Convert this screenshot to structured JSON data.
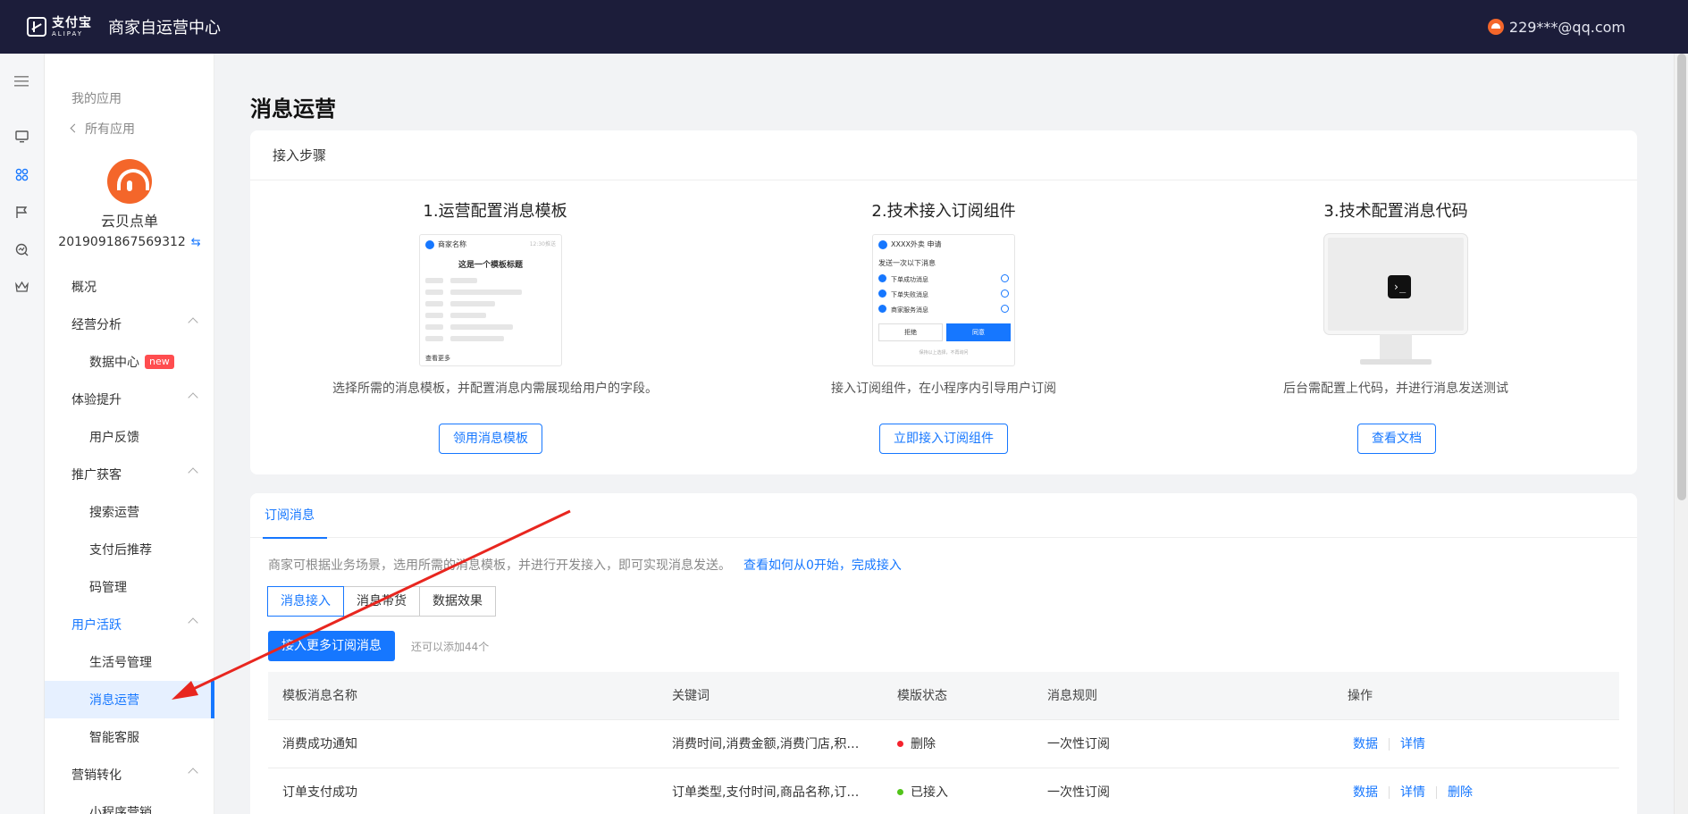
{
  "header": {
    "logo_cn": "支付宝",
    "logo_en": "ALIPAY",
    "title": "商家自运营中心",
    "user_email": "229***@qq.com"
  },
  "rail": {
    "icons": [
      "menu-icon",
      "monitor-icon",
      "apps-icon",
      "flag-icon",
      "analytics-icon",
      "crown-icon"
    ]
  },
  "sidebar": {
    "my_apps": "我的应用",
    "all_apps": "所有应用",
    "app_name": "云贝点单",
    "app_id": "2019091867569312",
    "swap_glyph": "⇆",
    "new_badge": "new",
    "items": [
      {
        "label": "概况",
        "type": "group"
      },
      {
        "label": "经营分析",
        "type": "group"
      },
      {
        "label": "数据中心",
        "type": "sub"
      },
      {
        "label": "体验提升",
        "type": "group"
      },
      {
        "label": "用户反馈",
        "type": "sub"
      },
      {
        "label": "推广获客",
        "type": "group"
      },
      {
        "label": "搜索运营",
        "type": "sub"
      },
      {
        "label": "支付后推荐",
        "type": "sub"
      },
      {
        "label": "码管理",
        "type": "sub"
      },
      {
        "label": "用户活跃",
        "type": "group"
      },
      {
        "label": "生活号管理",
        "type": "sub"
      },
      {
        "label": "消息运营",
        "type": "sub"
      },
      {
        "label": "智能客服",
        "type": "sub"
      },
      {
        "label": "营销转化",
        "type": "group"
      },
      {
        "label": "小程序营销",
        "type": "sub"
      }
    ]
  },
  "main": {
    "page_title": "消息运营",
    "steps_card": {
      "header": "接入步骤",
      "steps": [
        {
          "title": "1.运营配置消息模板",
          "desc": "选择所需的消息模板，并配置消息内需展现给用户的字段。",
          "button": "领用消息模板",
          "mock": {
            "merchant": "商家名称",
            "time": "12:30推送",
            "heading": "这是一个模板标题",
            "more": "查看更多"
          }
        },
        {
          "title": "2.技术接入订阅组件",
          "desc": "接入订阅组件，在小程序内引导用户订阅",
          "button": "立即接入订阅组件",
          "mock": {
            "merchant": "XXXX外卖 申请",
            "heading": "发送一次以下消息",
            "opt1": "下单成功消息",
            "opt2": "下单失败消息",
            "opt3": "商家服务消息",
            "reject": "拒绝",
            "agree": "同意",
            "remember": "保持以上选择，不再询问"
          }
        },
        {
          "title": "3.技术配置消息代码",
          "desc": "后台需配置上代码，并进行消息发送测试",
          "button": "查看文档",
          "terminal_glyph": "›_"
        }
      ]
    },
    "subscribe_card": {
      "tab": "订阅消息",
      "intro": "商家可根据业务场景，选用所需的消息模板，并进行开发接入，即可实现消息发送。",
      "intro_link": "查看如何从0开始，完成接入",
      "segments": [
        "消息接入",
        "消息带货",
        "数据效果"
      ],
      "primary_button": "接入更多订阅消息",
      "remaining": "还可以添加44个",
      "table": {
        "columns": [
          "模板消息名称",
          "关键词",
          "模版状态",
          "消息规则",
          "操作"
        ],
        "rows": [
          {
            "name": "消费成功通知",
            "keywords": "消费时间,消费金额,消费门店,积分…",
            "status": "删除",
            "status_color": "#f5222d",
            "rule": "一次性订阅",
            "ops": [
              "数据",
              "详情"
            ]
          },
          {
            "name": "订单支付成功",
            "keywords": "订单类型,支付时间,商品名称,订单…",
            "status": "已接入",
            "status_color": "#52c41a",
            "rule": "一次性订阅",
            "ops": [
              "数据",
              "详情",
              "删除"
            ]
          }
        ]
      }
    }
  },
  "colors": {
    "accent": "#1677ff",
    "topbar": "#1c1d3a",
    "annotation_arrow": "#e8261f"
  }
}
